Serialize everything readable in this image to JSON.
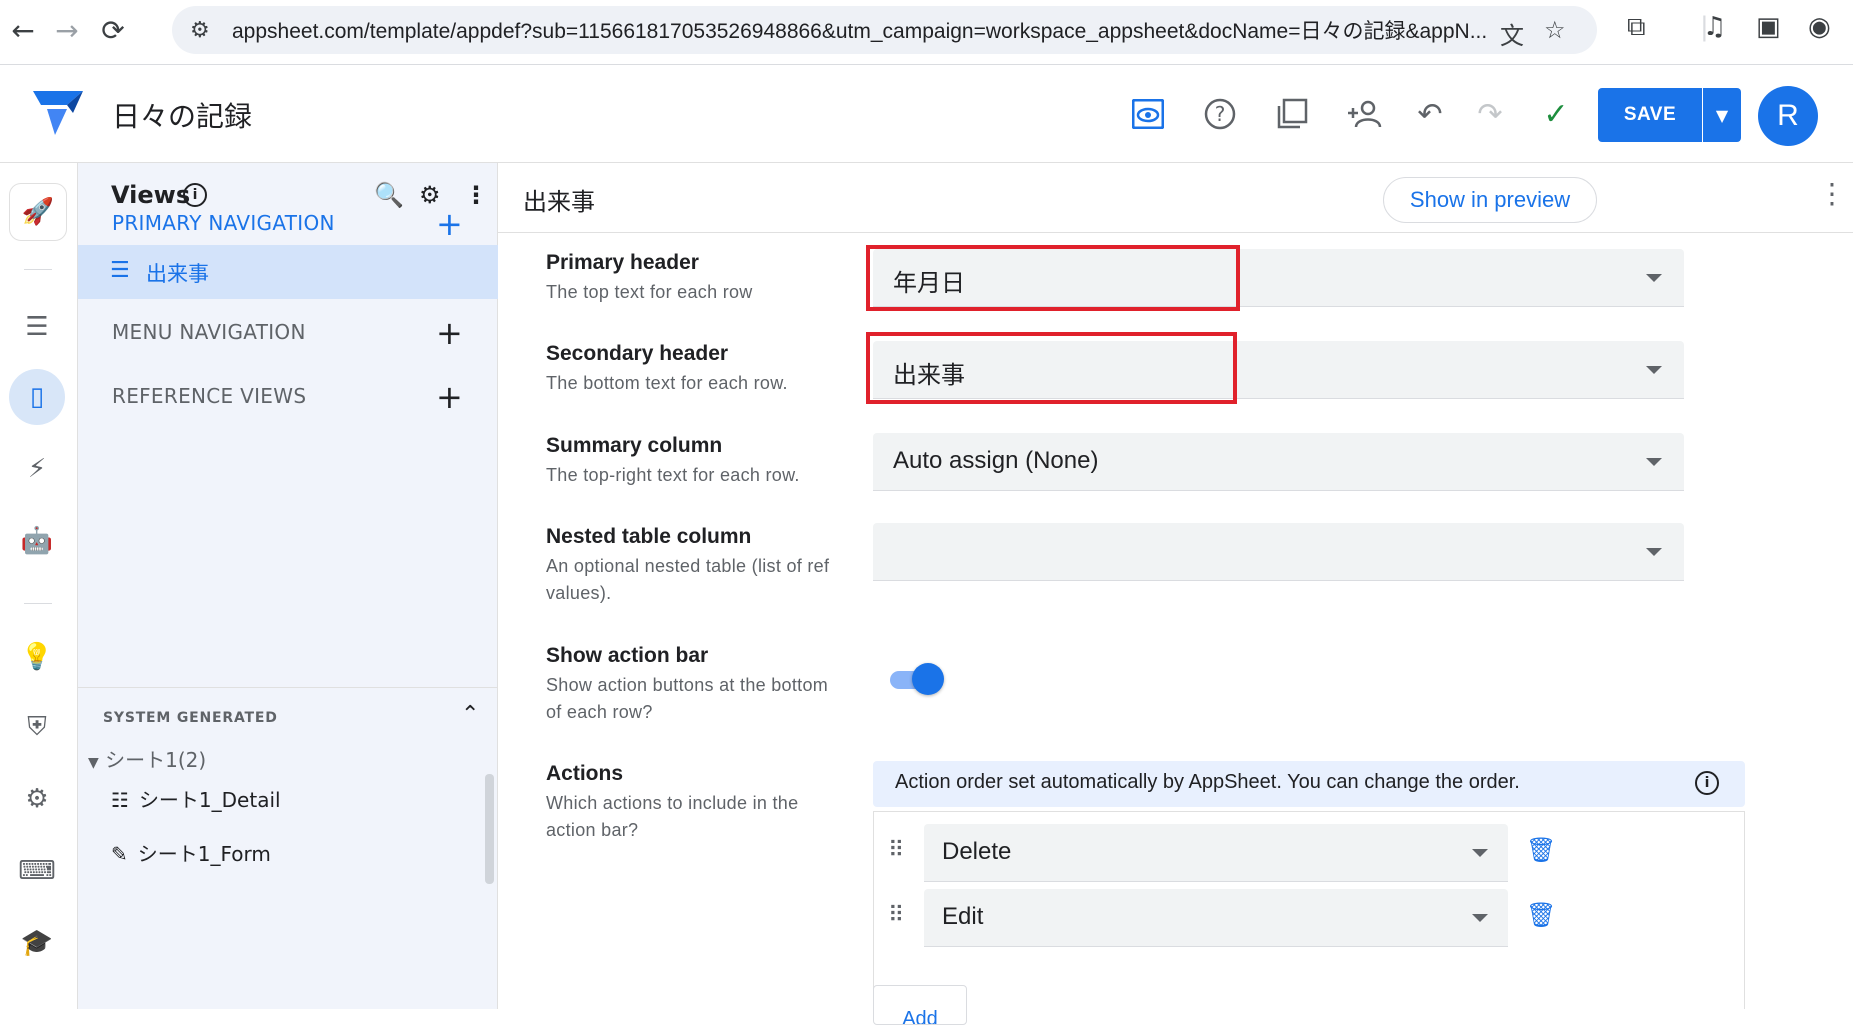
{
  "browser": {
    "url": "appsheet.com/template/appdef?sub=115661817053526948866&utm_campaign=workspace_appsheet&docName=日々の記録&appN...",
    "back_icon": "←",
    "forward_icon": "→",
    "reload_icon": "⟳"
  },
  "app": {
    "title": "日々の記録",
    "save_label": "SAVE",
    "avatar_initial": "R",
    "accent": "#1a73e8"
  },
  "panel": {
    "title": "Views",
    "primary_nav_label": "PRIMARY NAVIGATION",
    "primary_items": [
      {
        "label": "出来事"
      }
    ],
    "menu_nav_label": "MENU NAVIGATION",
    "reference_views_label": "REFERENCE VIEWS",
    "system_generated_label": "SYSTEM GENERATED",
    "system_groups": [
      {
        "name": "シート1",
        "count": "(2)"
      }
    ],
    "system_items": [
      {
        "label": "シート1_Detail"
      },
      {
        "label": "シート1_Form"
      }
    ]
  },
  "main": {
    "title": "出来事",
    "preview_label": "Show in preview",
    "fields": [
      {
        "label": "Primary header",
        "desc": "The top text for each row",
        "value": "年月日"
      },
      {
        "label": "Secondary header",
        "desc": "The bottom text for each row.",
        "value": "出来事"
      },
      {
        "label": "Summary column",
        "desc": "The top-right text for each row.",
        "value": "Auto assign (None)"
      },
      {
        "label": "Nested table column",
        "desc": "An optional nested table (list of ref values).",
        "value": ""
      },
      {
        "label": "Show action bar",
        "desc": "Show action buttons at the bottom of each row?",
        "toggle_on": true
      },
      {
        "label": "Actions",
        "desc": "Which actions to include in the action bar?"
      }
    ],
    "actions_info": "Action order set automatically by AppSheet. You can change the order.",
    "actions": [
      {
        "value": "Delete"
      },
      {
        "value": "Edit"
      }
    ],
    "add_label": "Add"
  }
}
